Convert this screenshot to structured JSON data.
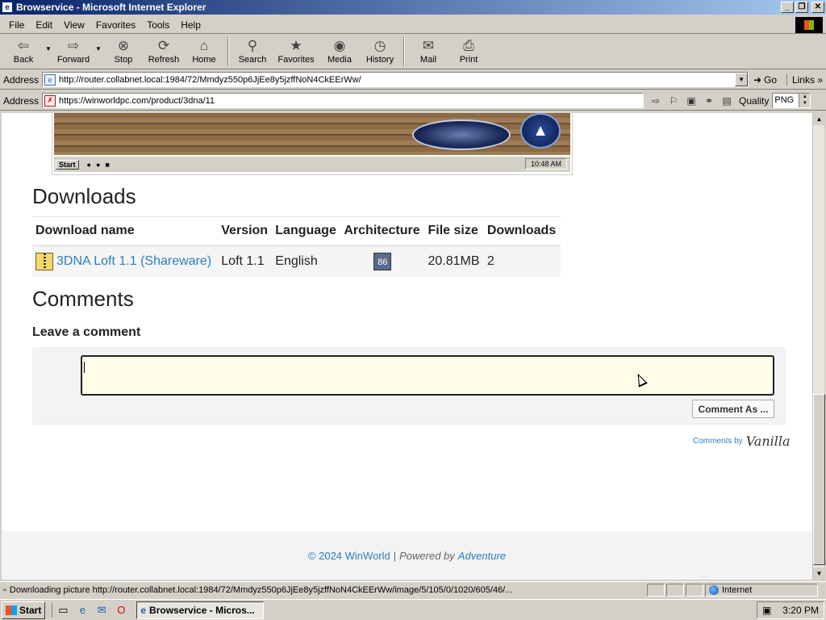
{
  "window": {
    "title": "Browservice - Microsoft Internet Explorer"
  },
  "menu": [
    "File",
    "Edit",
    "View",
    "Favorites",
    "Tools",
    "Help"
  ],
  "toolbar": {
    "back": "Back",
    "forward": "Forward",
    "stop": "Stop",
    "refresh": "Refresh",
    "home": "Home",
    "search": "Search",
    "favorites": "Favorites",
    "media": "Media",
    "history": "History",
    "mail": "Mail",
    "print": "Print"
  },
  "address1": {
    "label": "Address",
    "url": "http://router.collabnet.local:1984/72/Mmdyz550p6JjEe8y5jzffNoN4CkEErWw/",
    "go": "Go",
    "links": "Links"
  },
  "address2": {
    "label": "Address",
    "url": "https://winworldpc.com/product/3dna/11",
    "quality_label": "Quality",
    "quality_value": "PNG"
  },
  "screenshot": {
    "start": "Start",
    "clock": "10:48 AM"
  },
  "downloads": {
    "heading": "Downloads",
    "columns": [
      "Download name",
      "Version",
      "Language",
      "Architecture",
      "File size",
      "Downloads"
    ],
    "rows": [
      {
        "name": "3DNA Loft 1.1 (Shareware)",
        "version": "Loft 1.1",
        "language": "English",
        "architecture_icon": "x86-icon",
        "size": "20.81MB",
        "downloads": "2"
      }
    ]
  },
  "comments": {
    "heading": "Comments",
    "leave": "Leave a comment",
    "input_value": "",
    "button": "Comment As ...",
    "powered_by": "Comments by",
    "vanilla": "Vanilla"
  },
  "footer": {
    "copyright": "© 2024 WinWorld",
    "sep": "|",
    "powered": "Powered by",
    "adventure": "Adventure"
  },
  "status": {
    "message": "Downloading picture http://router.collabnet.local:1984/72/Mmdyz550p6JjEe8y5jzffNoN4CkEErWw/image/5/105/0/1020/605/46/...",
    "zone": "Internet"
  },
  "taskbar": {
    "start": "Start",
    "task": "Browservice - Micros...",
    "clock": "3:20 PM"
  },
  "colors": {
    "link": "#2a7fc1",
    "title_gradient_start": "#0a246a"
  }
}
